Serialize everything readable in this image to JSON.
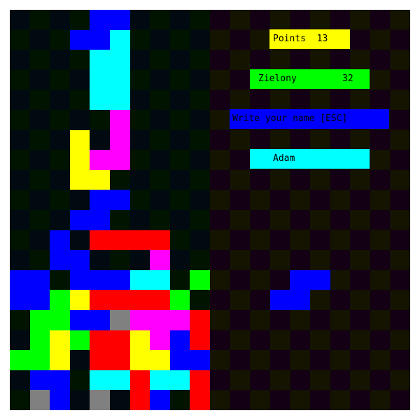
{
  "colors": {
    "yellow": "#ffff00",
    "green": "#00ff00",
    "blue": "#0000ff",
    "cyan": "#00ffff",
    "magenta": "#ff00ff",
    "red": "#ff0000",
    "gray": "#808080",
    "text": "#000000"
  },
  "points": {
    "label": "Points",
    "value": "13",
    "color": "#ffff00"
  },
  "player": {
    "name": "Zielony",
    "score": "32",
    "color": "#00ff00"
  },
  "prompt": {
    "text": "Write your name [ESC]",
    "color": "#0000ff"
  },
  "name_input": {
    "value": "Adam",
    "color": "#00ffff"
  },
  "board": {
    "columns": 10,
    "rows": 20,
    "cells": [
      [
        4,
        0,
        "blue"
      ],
      [
        5,
        0,
        "blue"
      ],
      [
        3,
        1,
        "blue"
      ],
      [
        4,
        1,
        "blue"
      ],
      [
        5,
        1,
        "cyan"
      ],
      [
        4,
        2,
        "cyan"
      ],
      [
        5,
        2,
        "cyan"
      ],
      [
        4,
        3,
        "cyan"
      ],
      [
        5,
        3,
        "cyan"
      ],
      [
        4,
        4,
        "cyan"
      ],
      [
        5,
        4,
        "cyan"
      ],
      [
        5,
        5,
        "magenta"
      ],
      [
        3,
        6,
        "yellow"
      ],
      [
        5,
        6,
        "magenta"
      ],
      [
        3,
        7,
        "yellow"
      ],
      [
        4,
        7,
        "magenta"
      ],
      [
        5,
        7,
        "magenta"
      ],
      [
        3,
        8,
        "yellow"
      ],
      [
        4,
        8,
        "yellow"
      ],
      [
        4,
        9,
        "blue"
      ],
      [
        5,
        9,
        "blue"
      ],
      [
        3,
        10,
        "blue"
      ],
      [
        4,
        10,
        "blue"
      ],
      [
        2,
        11,
        "blue"
      ],
      [
        4,
        11,
        "red"
      ],
      [
        5,
        11,
        "red"
      ],
      [
        6,
        11,
        "red"
      ],
      [
        7,
        11,
        "red"
      ],
      [
        2,
        12,
        "blue"
      ],
      [
        3,
        12,
        "blue"
      ],
      [
        7,
        12,
        "magenta"
      ],
      [
        0,
        13,
        "blue"
      ],
      [
        1,
        13,
        "blue"
      ],
      [
        3,
        13,
        "blue"
      ],
      [
        4,
        13,
        "blue"
      ],
      [
        5,
        13,
        "blue"
      ],
      [
        6,
        13,
        "cyan"
      ],
      [
        7,
        13,
        "cyan"
      ],
      [
        9,
        13,
        "green"
      ],
      [
        0,
        14,
        "blue"
      ],
      [
        1,
        14,
        "blue"
      ],
      [
        2,
        14,
        "green"
      ],
      [
        3,
        14,
        "yellow"
      ],
      [
        4,
        14,
        "red"
      ],
      [
        5,
        14,
        "red"
      ],
      [
        6,
        14,
        "red"
      ],
      [
        7,
        14,
        "red"
      ],
      [
        8,
        14,
        "green"
      ],
      [
        1,
        15,
        "green"
      ],
      [
        2,
        15,
        "green"
      ],
      [
        3,
        15,
        "blue"
      ],
      [
        4,
        15,
        "blue"
      ],
      [
        5,
        15,
        "gray"
      ],
      [
        6,
        15,
        "magenta"
      ],
      [
        7,
        15,
        "magenta"
      ],
      [
        8,
        15,
        "magenta"
      ],
      [
        9,
        15,
        "red"
      ],
      [
        1,
        16,
        "green"
      ],
      [
        2,
        16,
        "yellow"
      ],
      [
        3,
        16,
        "green"
      ],
      [
        4,
        16,
        "red"
      ],
      [
        5,
        16,
        "red"
      ],
      [
        6,
        16,
        "yellow"
      ],
      [
        7,
        16,
        "magenta"
      ],
      [
        8,
        16,
        "blue"
      ],
      [
        9,
        16,
        "red"
      ],
      [
        0,
        17,
        "green"
      ],
      [
        1,
        17,
        "green"
      ],
      [
        2,
        17,
        "yellow"
      ],
      [
        4,
        17,
        "red"
      ],
      [
        5,
        17,
        "red"
      ],
      [
        6,
        17,
        "yellow"
      ],
      [
        7,
        17,
        "yellow"
      ],
      [
        8,
        17,
        "blue"
      ],
      [
        9,
        17,
        "blue"
      ],
      [
        1,
        18,
        "blue"
      ],
      [
        2,
        18,
        "blue"
      ],
      [
        4,
        18,
        "cyan"
      ],
      [
        5,
        18,
        "cyan"
      ],
      [
        6,
        18,
        "red"
      ],
      [
        7,
        18,
        "cyan"
      ],
      [
        8,
        18,
        "cyan"
      ],
      [
        9,
        18,
        "red"
      ],
      [
        1,
        19,
        "gray"
      ],
      [
        2,
        19,
        "blue"
      ],
      [
        4,
        19,
        "gray"
      ],
      [
        6,
        19,
        "red"
      ],
      [
        7,
        19,
        "blue"
      ],
      [
        9,
        19,
        "red"
      ]
    ]
  },
  "next_piece": {
    "cells": [
      [
        4,
        13,
        "blue"
      ],
      [
        5,
        13,
        "blue"
      ],
      [
        3,
        14,
        "blue"
      ],
      [
        4,
        14,
        "blue"
      ]
    ]
  }
}
